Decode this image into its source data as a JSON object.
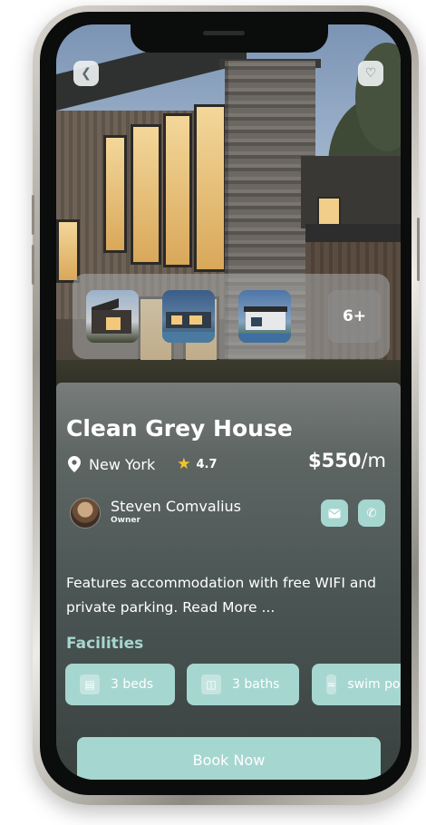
{
  "header": {
    "back_icon": "chevron-left-icon",
    "favorite_icon": "heart-icon"
  },
  "gallery": {
    "more_label": "6+"
  },
  "property": {
    "title": "Clean Grey House",
    "location": "New York",
    "rating": "4.7",
    "price_amount": "$550",
    "price_period": "/m"
  },
  "owner": {
    "name": "Steven Comvalius",
    "role": "Owner"
  },
  "description": "Features accommodation with free WIFI and private parking. Read More ...",
  "facilities": {
    "title": "Facilities",
    "items": [
      {
        "label": "3 beds",
        "icon": "bed-icon"
      },
      {
        "label": "3 baths",
        "icon": "bathtub-icon"
      },
      {
        "label": "swim pool",
        "icon": "waves-icon"
      }
    ]
  },
  "actions": {
    "book_label": "Book Now"
  },
  "colors": {
    "accent": "#a6d6d0",
    "star": "#f4c430"
  }
}
